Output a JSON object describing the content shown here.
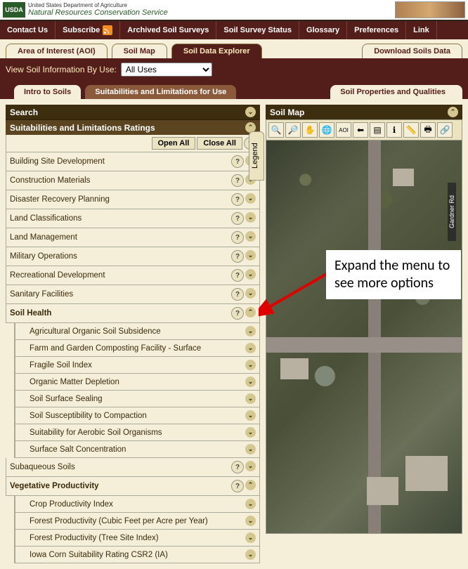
{
  "header": {
    "usda": "USDA",
    "line1": "United States Department of Agriculture",
    "line2": "Natural Resources Conservation Service"
  },
  "topnav": [
    "Contact Us",
    "Subscribe",
    "Archived Soil Surveys",
    "Soil Survey Status",
    "Glossary",
    "Preferences",
    "Link"
  ],
  "main_tabs": {
    "aoi": "Area of Interest (AOI)",
    "soil_map": "Soil Map",
    "explorer": "Soil Data Explorer",
    "download": "Download Soils Data"
  },
  "filter": {
    "label": "View Soil Information By Use:",
    "selected": "All Uses"
  },
  "sub_tabs": {
    "intro": "Intro to Soils",
    "suit": "Suitabilities and Limitations for Use",
    "props": "Soil Properties and Qualities"
  },
  "left": {
    "search": "Search",
    "ratings_header": "Suitabilities and Limitations Ratings",
    "open_all": "Open All",
    "close_all": "Close All",
    "help": "?",
    "categories": [
      {
        "label": "Building Site Development",
        "bold": false
      },
      {
        "label": "Construction Materials",
        "bold": false
      },
      {
        "label": "Disaster Recovery Planning",
        "bold": false
      },
      {
        "label": "Land Classifications",
        "bold": false
      },
      {
        "label": "Land Management",
        "bold": false
      },
      {
        "label": "Military Operations",
        "bold": false
      },
      {
        "label": "Recreational Development",
        "bold": false
      },
      {
        "label": "Sanitary Facilities",
        "bold": false
      }
    ],
    "soil_health": "Soil Health",
    "soil_health_items": [
      "Agricultural Organic Soil Subsidence",
      "Farm and Garden Composting Facility - Surface",
      "Fragile Soil Index",
      "Organic Matter Depletion",
      "Soil Surface Sealing",
      "Soil Susceptibility to Compaction",
      "Suitability for Aerobic Soil Organisms",
      "Surface Salt Concentration"
    ],
    "subaqueous": "Subaqueous Soils",
    "veg_prod": "Vegetative Productivity",
    "veg_items": [
      "Crop Productivity Index",
      "Forest Productivity (Cubic Feet per Acre per Year)",
      "Forest Productivity (Tree Site Index)",
      "Iowa Corn Suitability Rating CSR2 (IA)"
    ]
  },
  "right": {
    "map_header": "Soil Map",
    "legend": "Legend",
    "road": "Gardner Rd"
  },
  "annotation": "Expand the menu to see more options"
}
